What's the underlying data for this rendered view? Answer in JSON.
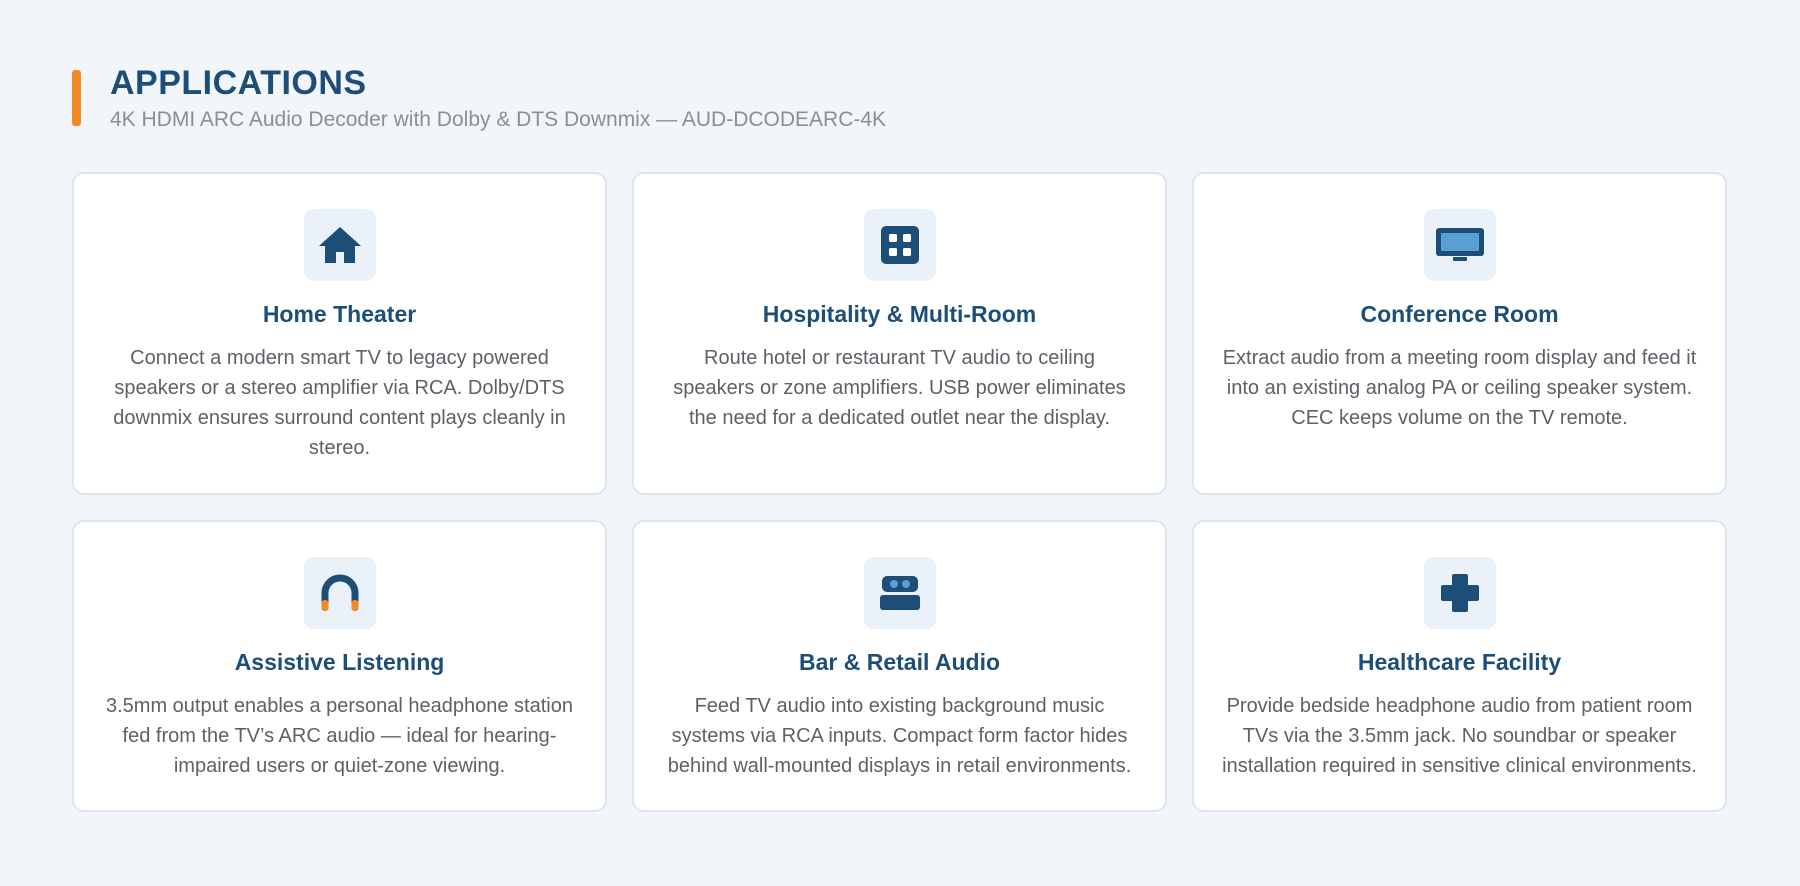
{
  "header": {
    "title": "APPLICATIONS",
    "subtitle": "4K HDMI ARC Audio Decoder with Dolby & DTS Downmix — AUD-DCODEARC-4K"
  },
  "colors": {
    "accent": "#f08a24",
    "primary": "#1c4e78",
    "icon_light": "#5a9fd4"
  },
  "cards": [
    {
      "icon": "house-icon",
      "title": "Home Theater",
      "text": "Connect a modern smart TV to legacy powered speakers or a stereo amplifier via RCA. Dolby/DTS downmix ensures surround content plays cleanly in stereo."
    },
    {
      "icon": "grid-icon",
      "title": "Hospitality & Multi-Room",
      "text": "Route hotel or restaurant TV audio to ceiling speakers or zone amplifiers. USB power eliminates the need for a dedicated outlet near the display."
    },
    {
      "icon": "monitor-icon",
      "title": "Conference Room",
      "text": "Extract audio from a meeting room display and feed it into an existing analog PA or ceiling speaker system. CEC keeps volume on the TV remote."
    },
    {
      "icon": "headphones-icon",
      "title": "Assistive Listening",
      "text": "3.5mm output enables a personal headphone station fed from the TV’s ARC audio — ideal for hearing-impaired users or quiet-zone viewing."
    },
    {
      "icon": "speaker-icon",
      "title": "Bar & Retail Audio",
      "text": "Feed TV audio into existing background music systems via RCA inputs. Compact form factor hides behind wall-mounted displays in retail environments."
    },
    {
      "icon": "medical-cross-icon",
      "title": "Healthcare Facility",
      "text": "Provide bedside headphone audio from patient room TVs via the 3.5mm jack. No soundbar or speaker installation required in sensitive clinical environments."
    }
  ]
}
